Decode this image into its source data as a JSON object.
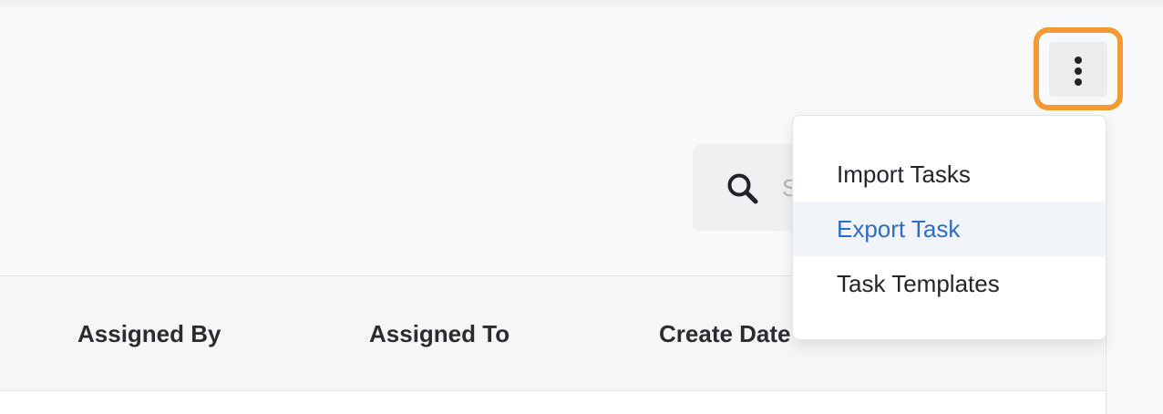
{
  "header": {
    "more_button_icon": "vertical-ellipsis-icon"
  },
  "search": {
    "icon": "search-icon",
    "placeholder": "S"
  },
  "table": {
    "columns": [
      "Assigned By",
      "Assigned To",
      "Create Date"
    ]
  },
  "menu": {
    "items": [
      {
        "label": "Import Tasks"
      },
      {
        "label": "Export Task"
      },
      {
        "label": "Task Templates"
      }
    ],
    "highlighted_index": 1
  },
  "colors": {
    "highlight_outline": "#f39a35",
    "menu_active_text": "#2e6dc1",
    "menu_active_bg": "#f1f5f9"
  }
}
